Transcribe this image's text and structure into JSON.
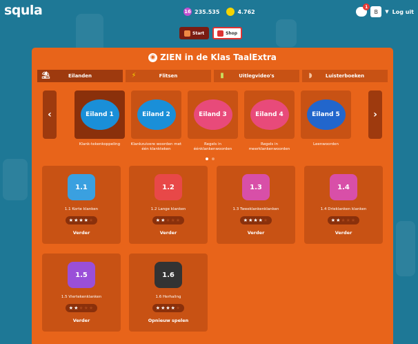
{
  "header": {
    "logo": "squla",
    "points": "235.535",
    "points_badge": "16",
    "coins": "4.762",
    "messages_badge": "1",
    "avatar_label": "B",
    "logout": "Log uit",
    "nav": [
      {
        "label": "Start"
      },
      {
        "label": "Shop"
      }
    ]
  },
  "panel": {
    "title": "ZIEN in de Klas TaalExtra",
    "tabs": [
      {
        "label": "Eilanden"
      },
      {
        "label": "Flitsen"
      },
      {
        "label": "Uitlegvideo's"
      },
      {
        "label": "Luisterboeken"
      }
    ],
    "arrow_prev": "‹",
    "arrow_next": "›",
    "islands": [
      {
        "badge": "Eiland 1",
        "name": "Klank-tekenkoppeling",
        "color": "#1a8fd8"
      },
      {
        "badge": "Eiland 2",
        "name": "Klankzuivere woorden met één klankteken",
        "color": "#1a8fd8"
      },
      {
        "badge": "Eiland 3",
        "name": "Regels in éénklankenwoorden",
        "color": "#e84a7a"
      },
      {
        "badge": "Eiland 4",
        "name": "Regels in meerklankenwoorden",
        "color": "#e84a7a"
      },
      {
        "badge": "Eiland 5",
        "name": "Leenwoorden",
        "color": "#2266cc"
      }
    ],
    "cards": [
      {
        "badge": "1.1",
        "name": "1.1 Korte klanken",
        "stars": 4,
        "action": "Verder",
        "color": "#3aa0e0"
      },
      {
        "badge": "1.2",
        "name": "1.2 Lange klanken",
        "stars": 2,
        "action": "Verder",
        "color": "#e84848"
      },
      {
        "badge": "1.3",
        "name": "1.3 Tweeklankenklanken",
        "stars": 4,
        "action": "Verder",
        "color": "#d84fa8"
      },
      {
        "badge": "1.4",
        "name": "1.4 Drieklanken klanken",
        "stars": 2,
        "action": "Verder",
        "color": "#d84fa8"
      },
      {
        "badge": "1.5",
        "name": "1.5 Viertekenklanken",
        "stars": 2,
        "action": "Verder",
        "color": "#9a4fd8"
      },
      {
        "badge": "1.6",
        "name": "1.6 Herhaling",
        "stars": 4,
        "action": "Opnieuw spelen",
        "color": "#333333"
      }
    ]
  }
}
